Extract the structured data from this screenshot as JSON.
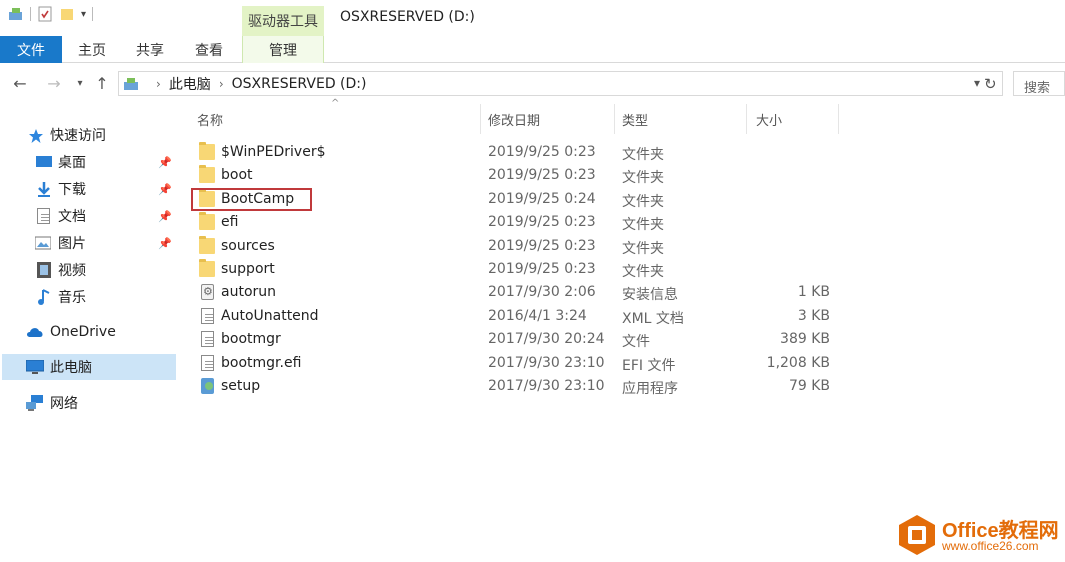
{
  "window": {
    "title": "OSXRESERVED (D:)",
    "context_tab": "驱动器工具"
  },
  "ribbon": {
    "tabs": [
      "文件",
      "主页",
      "共享",
      "查看",
      "管理"
    ]
  },
  "address": {
    "segments": [
      "此电脑",
      "OSXRESERVED (D:)"
    ],
    "search_placeholder": "搜索"
  },
  "sidebar": {
    "items": [
      {
        "label": "快速访问",
        "icon": "star-icon"
      },
      {
        "label": "桌面",
        "icon": "desktop-icon",
        "pinned": true
      },
      {
        "label": "下载",
        "icon": "download-icon",
        "pinned": true
      },
      {
        "label": "文档",
        "icon": "document-icon",
        "pinned": true
      },
      {
        "label": "图片",
        "icon": "pictures-icon",
        "pinned": true
      },
      {
        "label": "视频",
        "icon": "video-icon"
      },
      {
        "label": "音乐",
        "icon": "music-icon"
      },
      {
        "label": "OneDrive",
        "icon": "cloud-icon"
      },
      {
        "label": "此电脑",
        "icon": "computer-icon",
        "selected": true
      },
      {
        "label": "网络",
        "icon": "network-icon"
      }
    ]
  },
  "columns": {
    "name": "名称",
    "date": "修改日期",
    "type": "类型",
    "size": "大小"
  },
  "files": [
    {
      "name": "$WinPEDriver$",
      "date": "2019/9/25 0:23",
      "type": "文件夹",
      "size": "",
      "icon": "folder-icon"
    },
    {
      "name": "boot",
      "date": "2019/9/25 0:23",
      "type": "文件夹",
      "size": "",
      "icon": "folder-icon"
    },
    {
      "name": "BootCamp",
      "date": "2019/9/25 0:24",
      "type": "文件夹",
      "size": "",
      "icon": "folder-icon",
      "highlighted": true
    },
    {
      "name": "efi",
      "date": "2019/9/25 0:23",
      "type": "文件夹",
      "size": "",
      "icon": "folder-icon"
    },
    {
      "name": "sources",
      "date": "2019/9/25 0:23",
      "type": "文件夹",
      "size": "",
      "icon": "folder-icon"
    },
    {
      "name": "support",
      "date": "2019/9/25 0:23",
      "type": "文件夹",
      "size": "",
      "icon": "folder-icon"
    },
    {
      "name": "autorun",
      "date": "2017/9/30 2:06",
      "type": "安装信息",
      "size": "1 KB",
      "icon": "setup-info-icon"
    },
    {
      "name": "AutoUnattend",
      "date": "2016/4/1 3:24",
      "type": "XML 文档",
      "size": "3 KB",
      "icon": "xml-file-icon"
    },
    {
      "name": "bootmgr",
      "date": "2017/9/30 20:24",
      "type": "文件",
      "size": "389 KB",
      "icon": "file-icon"
    },
    {
      "name": "bootmgr.efi",
      "date": "2017/9/30 23:10",
      "type": "EFI 文件",
      "size": "1,208 KB",
      "icon": "file-icon"
    },
    {
      "name": "setup",
      "date": "2017/9/30 23:10",
      "type": "应用程序",
      "size": "79 KB",
      "icon": "application-icon"
    }
  ],
  "watermark": {
    "brand": "Office教程网",
    "url": "www.office26.com"
  }
}
